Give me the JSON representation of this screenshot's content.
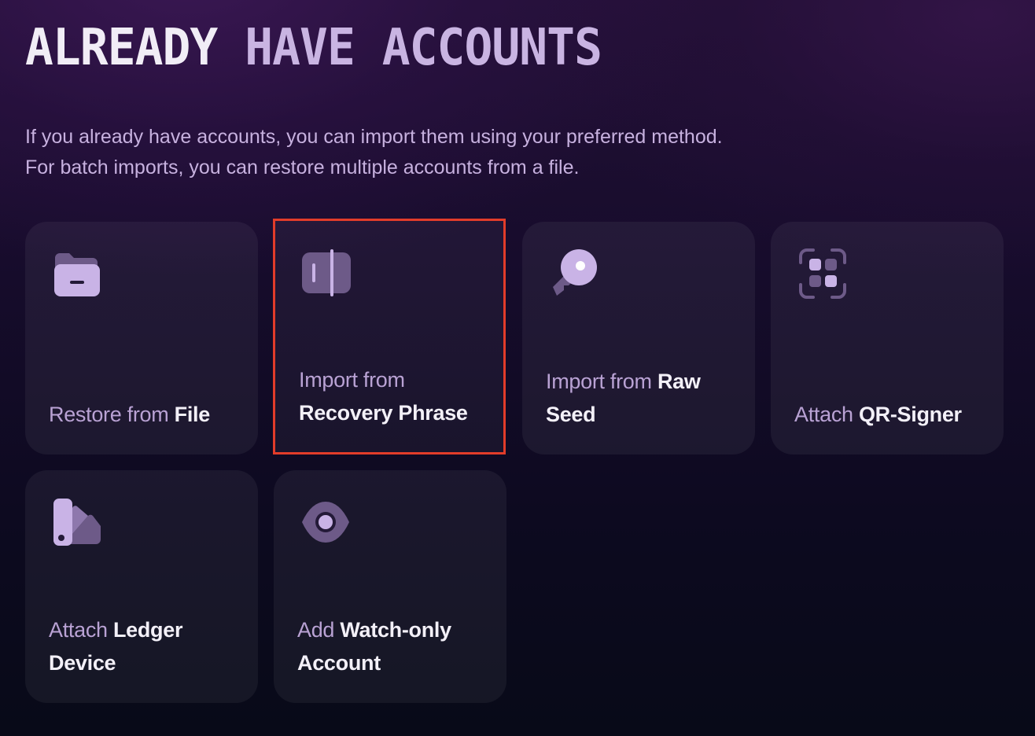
{
  "header": {
    "title_part1": "ALREADY",
    "title_part2": "HAVE ACCOUNTS",
    "description": "If you already have accounts, you can import them using your preferred method. For batch imports, you can restore multiple accounts from a file."
  },
  "options": [
    {
      "pre": "Restore from",
      "main": "File",
      "icon": "folder-icon",
      "selected": false
    },
    {
      "pre": "Import from",
      "main": "Recovery Phrase",
      "icon": "recovery-phrase-icon",
      "selected": true
    },
    {
      "pre": "Import from",
      "main": "Raw Seed",
      "icon": "key-icon",
      "selected": false
    },
    {
      "pre": "Attach",
      "main": "QR-Signer",
      "icon": "qr-scan-icon",
      "selected": false
    },
    {
      "pre": "Attach",
      "main": "Ledger Device",
      "icon": "ledger-icon",
      "selected": false
    },
    {
      "pre": "Add",
      "main": "Watch-only Account",
      "icon": "eye-icon",
      "selected": false
    }
  ],
  "colors": {
    "accent_light": "#c9b4e2",
    "icon_primary": "#c9b3e6",
    "icon_muted": "#6d5a88",
    "selection_outline": "#e23c2a"
  }
}
